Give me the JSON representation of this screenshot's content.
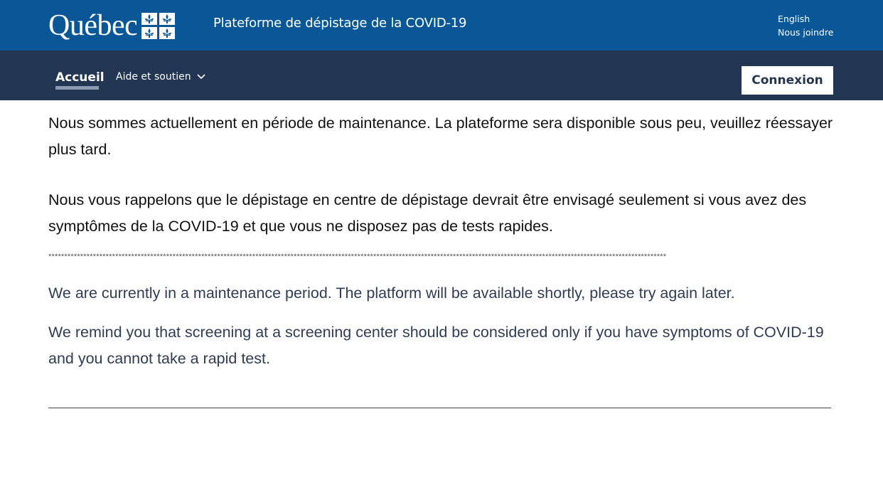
{
  "header": {
    "logo_text": "Québec",
    "platform_title": "Plateforme de dépistage de la COVID-19",
    "links": [
      "English",
      "Nous joindre"
    ]
  },
  "nav": {
    "home_label": "Accueil",
    "help_label": "Aide et soutien",
    "login_label": "Connexion"
  },
  "content": {
    "fr_maintenance": "Nous sommes actuellement en période de maintenance. La plateforme sera disponible sous peu, veuillez réessayer plus tard.",
    "fr_reminder": "Nous vous rappelons que le dépistage en centre de dépistage devrait être envisagé seulement si vous avez des symptômes de la COVID-19 et que vous ne disposez pas de tests rapides.",
    "separator": "**************************************************************************************************************************************************************************************************",
    "en_maintenance": "We are currently in a maintenance period. The platform will be available shortly, please try again later.",
    "en_reminder": "We remind you that screening at a screening center should be considered only if you have symptoms of COVID-19 and you cannot take a rapid test."
  },
  "colors": {
    "topbar": "#095797",
    "navbar": "#223654",
    "english_text": "#2e3d55"
  },
  "icons": {
    "flag": "fleur-de-lis-flag-icon",
    "dropdown": "chevron-down-icon"
  }
}
